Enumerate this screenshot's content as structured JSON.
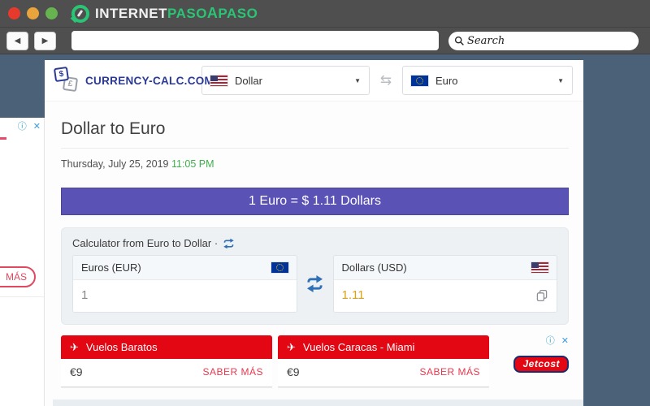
{
  "window": {
    "logo": {
      "internet": "INTERNET",
      "paso1": "PASO",
      "a": "A",
      "paso2": "PASO"
    },
    "search_label": "Search"
  },
  "icons": {
    "back": "◀",
    "forward": "▶",
    "caret": "▼",
    "swap": "⇆",
    "plane": "✈",
    "info": "ⓘ",
    "close": "✕"
  },
  "site_header": {
    "brand": "CURRENCY-CALC.COM",
    "brand_icon_front": "$",
    "brand_icon_back": "£",
    "from_currency": "Dollar",
    "to_currency": "Euro"
  },
  "page": {
    "title": "Dollar to Euro",
    "date": "Thursday, July 25, 2019",
    "time": "11:05 PM",
    "rate_banner": "1 Euro = $ 1.11 Dollars",
    "calculator": {
      "title": "Calculator from Euro to Dollar ·",
      "from": {
        "label": "Euros (EUR)",
        "value": "1"
      },
      "to": {
        "label": "Dollars (USD)",
        "value": "1.11"
      }
    }
  },
  "ads": {
    "left": {
      "more_label": "MÁS"
    },
    "bottom": {
      "items": [
        {
          "title": "Vuelos Baratos",
          "price": "€9",
          "cta": "SABER MÁS"
        },
        {
          "title": "Vuelos Caracas - Miami",
          "price": "€9",
          "cta": "SABER MÁS"
        }
      ],
      "brand": "Jetcost"
    }
  },
  "colors": {
    "chrome": "#4f4f4f",
    "page_bg": "#4b6178",
    "accent_purple": "#5a52b4",
    "ad_red": "#e30613",
    "brand_blue": "#2b3a94",
    "logo_green": "#2bc474",
    "time_green": "#3faf4c",
    "value_orange": "#d9a21b",
    "link_blue": "#2e6fb5"
  }
}
